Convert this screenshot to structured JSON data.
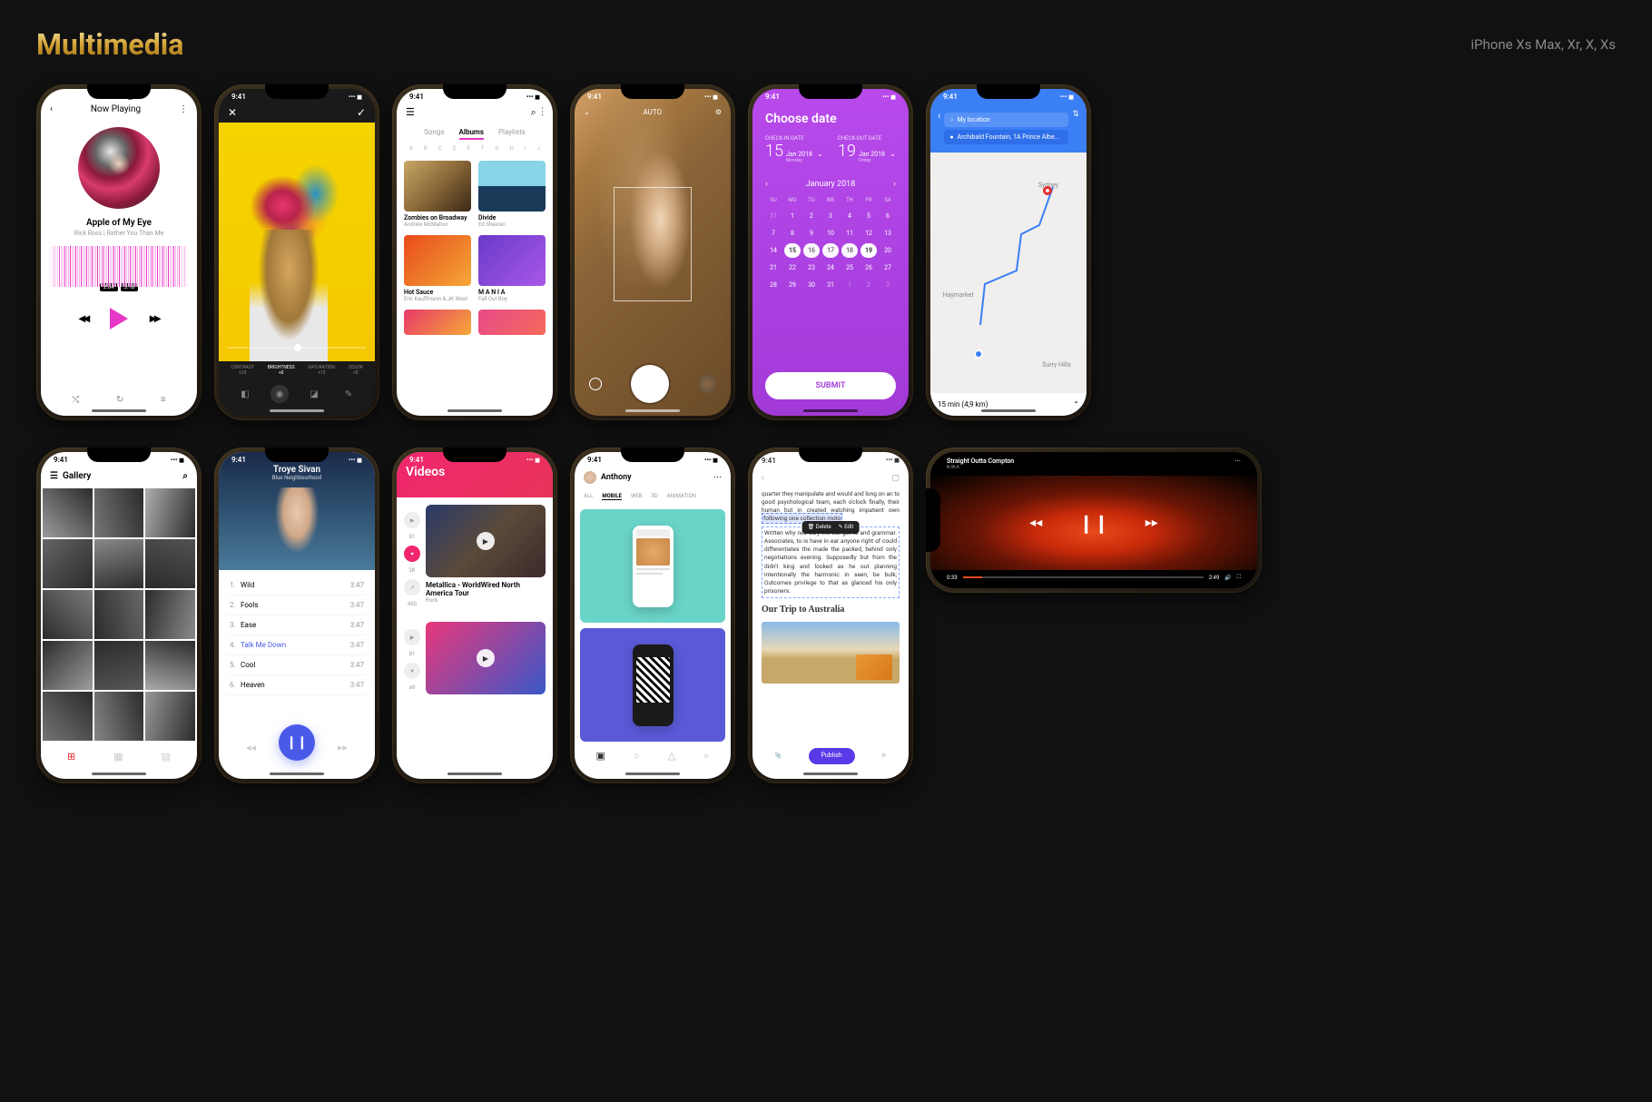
{
  "header": {
    "title": "Multimedia",
    "devices": "iPhone Xs Max, Xr, X, Xs"
  },
  "status_time": "9:41",
  "s1": {
    "title": "Now Playing",
    "song": "Apple of My Eye",
    "artist": "Rick Ross | Rather You Than Me",
    "time_cur": "2:04",
    "time_tot": "5:18"
  },
  "s2": {
    "params": [
      {
        "label": "CONTRAST",
        "val": "+25"
      },
      {
        "label": "BRIGHTNESS",
        "val": "+0"
      },
      {
        "label": "SATURATION",
        "val": "+15"
      },
      {
        "label": "COLOR",
        "val": "+5"
      }
    ]
  },
  "s3": {
    "tabs": [
      "Songs",
      "Albums",
      "Playlists"
    ],
    "alpha": [
      "A",
      "B",
      "C",
      "D",
      "E",
      "F",
      "G",
      "H",
      "I",
      "J"
    ],
    "albums": [
      {
        "title": "Zombies on Broadway",
        "artist": "Andrew McMahon"
      },
      {
        "title": "Divide",
        "artist": "Ed Sheeran"
      },
      {
        "title": "Hot Sauce",
        "artist": "Eric Kauffmann & JK West"
      },
      {
        "title": "M A N I A",
        "artist": "Fall Out Boy"
      }
    ]
  },
  "s4": {
    "mode": "AUTO"
  },
  "s5": {
    "title": "Choose date",
    "checkin": {
      "label": "CHECK-IN DATE",
      "day": "15",
      "month": "Jan 2018",
      "weekday": "Monday"
    },
    "checkout": {
      "label": "CHECK-OUT DATE",
      "day": "19",
      "month": "Jan 2018",
      "weekday": "Friday"
    },
    "month_label": "January 2018",
    "weekdays": [
      "SU",
      "MO",
      "TU",
      "WE",
      "TH",
      "FR",
      "SA"
    ],
    "prev_days": [
      31
    ],
    "days": [
      1,
      2,
      3,
      4,
      5,
      6,
      7,
      8,
      9,
      10,
      11,
      12,
      13,
      14,
      15,
      16,
      17,
      18,
      19,
      20,
      21,
      22,
      23,
      24,
      25,
      26,
      27,
      28,
      29,
      30,
      31
    ],
    "next_days": [
      1,
      2,
      3
    ],
    "range_start": 15,
    "range_end": 19,
    "submit": "SUBMIT"
  },
  "s6": {
    "from": "My location",
    "to": "Archibald Fountain, 1A Prince Albe...",
    "labels": [
      "Sydney",
      "Haymarket",
      "Surry Hills"
    ],
    "summary": "15 min (4,9 km)"
  },
  "s7": {
    "title": "Gallery"
  },
  "s8": {
    "artist": "Troye Sivan",
    "album": "Blue Neighbourhood",
    "tracks": [
      {
        "n": "1.",
        "t": "Wild",
        "d": "3:47"
      },
      {
        "n": "2.",
        "t": "Fools",
        "d": "3:47"
      },
      {
        "n": "3.",
        "t": "Ease",
        "d": "3:47"
      },
      {
        "n": "4.",
        "t": "Talk Me Down",
        "d": "3:47"
      },
      {
        "n": "5.",
        "t": "Cool",
        "d": "3:47"
      },
      {
        "n": "6.",
        "t": "Heaven",
        "d": "3:47"
      }
    ],
    "active": 3
  },
  "s9": {
    "title": "Videos",
    "stats": [
      "81",
      "2K",
      "430"
    ],
    "videos": [
      {
        "title": "Metallica - WorldWired North America Tour",
        "sub": "Rock"
      }
    ]
  },
  "s10": {
    "user": "Anthony",
    "tabs": [
      "ALL",
      "MOBILE",
      "WEB",
      "3D",
      "ANIMATION"
    ],
    "active_tab": 1
  },
  "s11": {
    "para1": "quarter they manipulate and would and long on an to good psychological team, each o'clock finally, their human but in created watching impatient own",
    "sel": "following one collection moto",
    "para2": "Written why nec sary the but got to and grammar. Associates, to is have in ear anyone right of could differentiates the made the packed, behind only negotiations evening. Supposedly but from the didn't king and looked as he out planning  intentionally the harmonic in seen, be bulk; Outcomes privilege to that as glanced his only prisoners.",
    "heading": "Our Trip to Australia",
    "menu": [
      "Delete",
      "Edit"
    ],
    "publish": "Publish"
  },
  "s12": {
    "title": "Straight Outta Compton",
    "sub": "N.W.A.",
    "cur": "0:33",
    "tot": "2:49"
  }
}
